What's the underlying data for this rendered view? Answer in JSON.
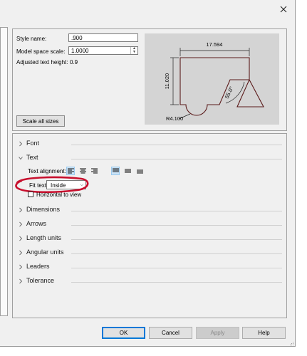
{
  "window": {
    "close_icon": "close-icon"
  },
  "top_panel": {
    "style_name_label": "Style name:",
    "style_name_value": ".900",
    "model_space_scale_label": "Model space scale:",
    "model_space_scale_value": "1.0000",
    "adjusted_text_height_label": "Adjusted text height:",
    "adjusted_text_height_value": "0.9",
    "scale_all_sizes_button": "Scale all sizes"
  },
  "preview": {
    "dim_horizontal": "17.594",
    "dim_vertical": "11.020",
    "dim_angle": "55.0°",
    "dim_radius": "R4.100",
    "line_color": "#5a1a1a"
  },
  "sections": {
    "font": "Font",
    "text": "Text",
    "dimensions": "Dimensions",
    "arrows": "Arrows",
    "length_units": "Length units",
    "angular_units": "Angular units",
    "leaders": "Leaders",
    "tolerance": "Tolerance"
  },
  "text_section": {
    "text_alignment_label": "Text alignment:",
    "fit_text_label": "Fit text:",
    "fit_text_value": "Inside",
    "horizontal_to_view_label": "Horizontal to view",
    "horizontal_to_view_checked": false
  },
  "annotation": {
    "circle_color": "#c8102e"
  },
  "buttons": {
    "ok": "OK",
    "cancel": "Cancel",
    "apply": "Apply",
    "help": "Help"
  }
}
